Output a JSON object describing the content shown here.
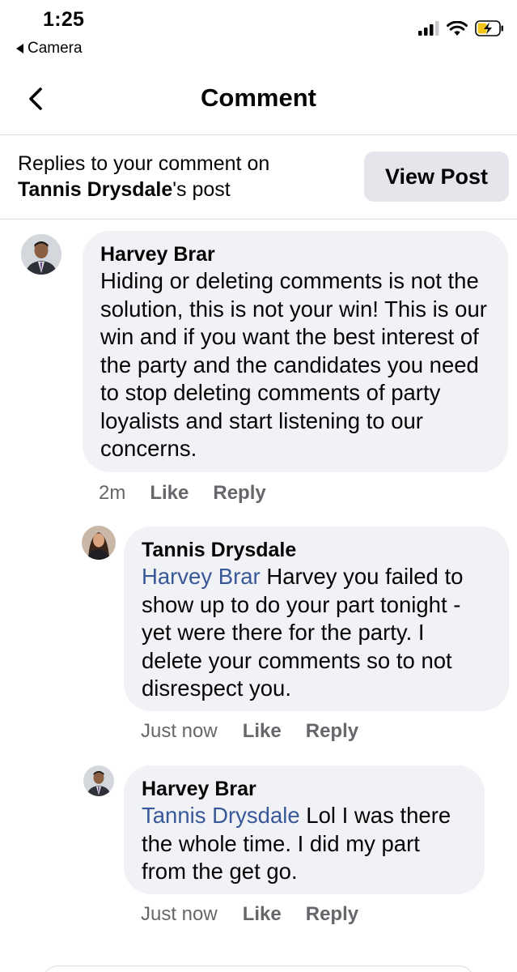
{
  "status_bar": {
    "time": "1:25",
    "back_app": "Camera"
  },
  "nav": {
    "title": "Comment",
    "back_icon": "chevron-left-icon"
  },
  "context": {
    "line1": "Replies to your comment on",
    "post_owner": "Tannis Drysdale",
    "post_suffix": "'s post",
    "view_post_label": "View Post"
  },
  "comments": [
    {
      "author": "Harvey Brar",
      "mention": "",
      "text": "Hiding or deleting comments is not the solution, this is not your win! This is our win and if you want the best interest of the party and the candidates you need to stop deleting comments of party loyalists and start listening to our concerns.",
      "time": "2m",
      "like": "Like",
      "reply": "Reply"
    },
    {
      "author": "Tannis Drysdale",
      "mention": "Harvey Brar",
      "text": " Harvey you failed to show up to do your part tonight - yet were there for the party. I delete your comments so to not disrespect you.",
      "time": "Just now",
      "like": "Like",
      "reply": "Reply"
    },
    {
      "author": "Harvey Brar",
      "mention": "Tannis Drysdale",
      "text": " Lol I was there the whole time. I did my part from the get go.",
      "time": "Just now",
      "like": "Like",
      "reply": "Reply"
    }
  ],
  "colors": {
    "bubble": "#f0f2f5",
    "mention": "#385898",
    "meta": "#65676b",
    "button": "#e4e6eb",
    "battery_charge": "#f5c518"
  }
}
